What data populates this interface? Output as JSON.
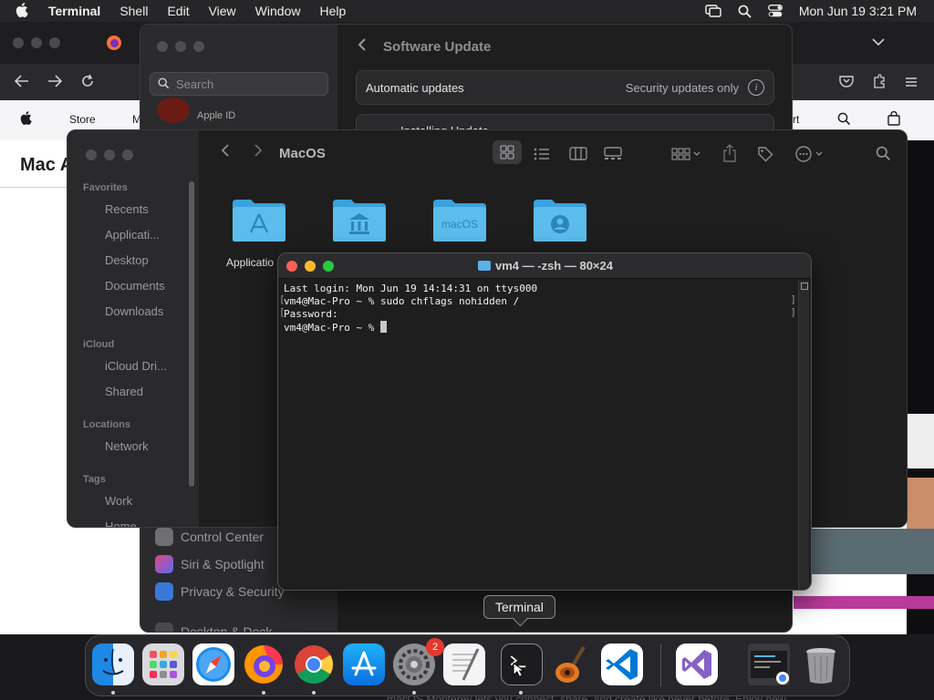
{
  "menubar": {
    "app": "Terminal",
    "items": [
      "Shell",
      "Edit",
      "View",
      "Window",
      "Help"
    ],
    "clock": "Mon Jun 19  3:21 PM"
  },
  "browser": {
    "nav_items": [
      "Store",
      "M",
      "rt"
    ],
    "page_heading": "Mac A",
    "footer_text": "macOS Monterey lets you connect, share, and create like never before. Enjoy new"
  },
  "settings": {
    "search_placeholder": "Search",
    "apple_id": "Apple ID",
    "title": "Software Update",
    "automatic_updates": "Automatic updates",
    "security_updates": "Security updates only",
    "installing": "Installing Update",
    "sidebar_items": [
      "Control Center",
      "Siri & Spotlight",
      "Privacy & Security",
      "Desktop & Dock"
    ]
  },
  "finder": {
    "title": "MacOS",
    "favorites_label": "Favorites",
    "favorites": [
      "Recents",
      "Applicati...",
      "Desktop",
      "Documents",
      "Downloads"
    ],
    "icloud_label": "iCloud",
    "icloud": [
      "iCloud Dri...",
      "Shared"
    ],
    "locations_label": "Locations",
    "locations": [
      "Network"
    ],
    "tags_label": "Tags",
    "tags": [
      "Work",
      "Home"
    ],
    "folder_label": "Applicatio",
    "macos_folder_text": "macOS"
  },
  "terminal": {
    "title": "vm4 — -zsh — 80×24",
    "lines": [
      "Last login: Mon Jun 19 14:14:31 on ttys000",
      "vm4@Mac-Pro ~ % sudo chflags nohidden /",
      "Password:",
      "vm4@Mac-Pro ~ % "
    ]
  },
  "tooltip": "Terminal",
  "dock": {
    "apps": [
      "Finder",
      "Launchpad",
      "Safari",
      "Firefox",
      "Chrome",
      "App Store",
      "System Settings",
      "TextEdit",
      "Terminal",
      "GarageBand",
      "Visual Studio Code",
      "Visual Studio",
      "Downloads",
      "Trash"
    ],
    "settings_badge": "2"
  }
}
